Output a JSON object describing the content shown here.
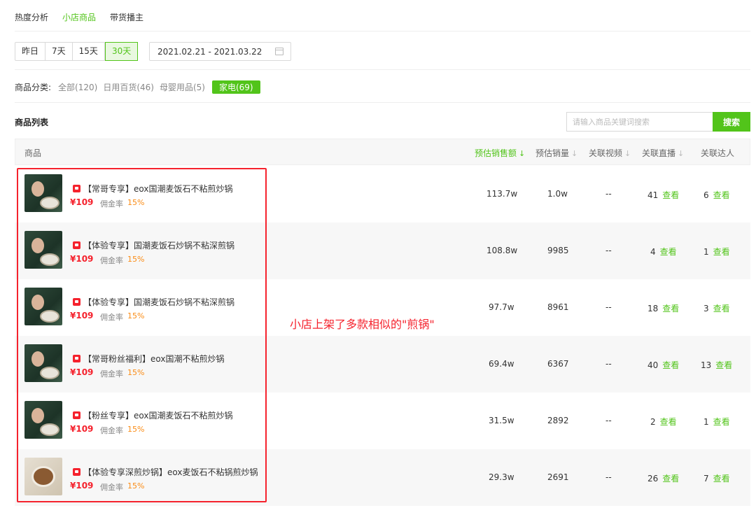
{
  "tabs": [
    {
      "label": "热度分析",
      "active": false
    },
    {
      "label": "小店商品",
      "active": true
    },
    {
      "label": "带货播主",
      "active": false
    }
  ],
  "date_filter": {
    "options": [
      "昨日",
      "7天",
      "15天",
      "30天"
    ],
    "selected": "30天",
    "range": "2021.02.21 - 2021.03.22"
  },
  "category": {
    "title": "商品分类:",
    "items": [
      "全部(120)",
      "日用百货(46)",
      "母婴用品(5)",
      "家电(69)"
    ],
    "selected": "家电(69)"
  },
  "list": {
    "title": "商品列表",
    "search_placeholder": "请输入商品关键词搜索",
    "search_button": "搜索"
  },
  "table": {
    "headers": {
      "product": "商品",
      "sales_amount": "预估销售额",
      "sales_volume": "预估销量",
      "videos": "关联视频",
      "lives": "关联直播",
      "influencers": "关联达人"
    },
    "sort_arrow": "↓",
    "view_link": "查看",
    "rows": [
      {
        "name": "【常哥专享】eox国潮麦饭石不粘煎炒锅",
        "price": "¥109",
        "commission_label": "佣金率",
        "commission": "15%",
        "sales_amount": "113.7w",
        "sales_volume": "1.0w",
        "videos": "--",
        "lives": "41",
        "influencers": "6"
      },
      {
        "name": "【体验专享】国潮麦饭石炒锅不粘深煎锅",
        "price": "¥109",
        "commission_label": "佣金率",
        "commission": "15%",
        "sales_amount": "108.8w",
        "sales_volume": "9985",
        "videos": "--",
        "lives": "4",
        "influencers": "1"
      },
      {
        "name": "【体验专享】国潮麦饭石炒锅不粘深煎锅",
        "price": "¥109",
        "commission_label": "佣金率",
        "commission": "15%",
        "sales_amount": "97.7w",
        "sales_volume": "8961",
        "videos": "--",
        "lives": "18",
        "influencers": "3"
      },
      {
        "name": "【常哥粉丝福利】eox国潮不粘煎炒锅",
        "price": "¥109",
        "commission_label": "佣金率",
        "commission": "15%",
        "sales_amount": "69.4w",
        "sales_volume": "6367",
        "videos": "--",
        "lives": "40",
        "influencers": "13"
      },
      {
        "name": "【粉丝专享】eox国潮麦饭石不粘煎炒锅",
        "price": "¥109",
        "commission_label": "佣金率",
        "commission": "15%",
        "sales_amount": "31.5w",
        "sales_volume": "2892",
        "videos": "--",
        "lives": "2",
        "influencers": "1"
      },
      {
        "name": "【体验专享深煎炒锅】eox麦饭石不粘锅煎炒锅",
        "price": "¥109",
        "commission_label": "佣金率",
        "commission": "15%",
        "sales_amount": "29.3w",
        "sales_volume": "2691",
        "videos": "--",
        "lives": "26",
        "influencers": "7"
      }
    ]
  },
  "annotation": "小店上架了多款相似的\"煎锅\"",
  "colors": {
    "accent": "#52c41a",
    "price": "#f5222d",
    "commission": "#fa8c16",
    "annotation": "#f5222d"
  }
}
